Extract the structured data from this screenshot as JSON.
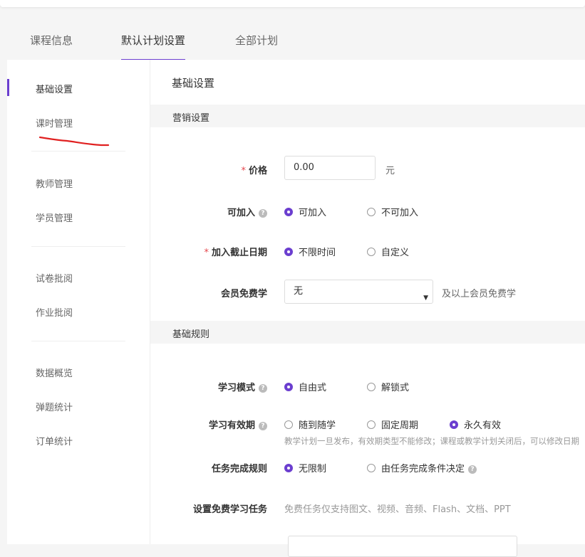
{
  "tabs": [
    "课程信息",
    "默认计划设置",
    "全部计划"
  ],
  "sidebar": {
    "items": [
      "基础设置",
      "课时管理",
      "教师管理",
      "学员管理",
      "试卷批阅",
      "作业批阅",
      "数据概览",
      "弹题统计",
      "订单统计"
    ]
  },
  "content": {
    "title": "基础设置",
    "marketing": {
      "header": "营销设置",
      "price_label": "价格",
      "price_value": "0.00",
      "price_unit": "元",
      "joinable_label": "可加入",
      "joinable_options": [
        "可加入",
        "不可加入"
      ],
      "deadline_label": "加入截止日期",
      "deadline_options": [
        "不限时间",
        "自定义"
      ],
      "vip_label": "会员免费学",
      "vip_selected": "无",
      "vip_suffix": "及以上会员免费学"
    },
    "rules": {
      "header": "基础规则",
      "mode_label": "学习模式",
      "mode_options": [
        "自由式",
        "解锁式"
      ],
      "validity_label": "学习有效期",
      "validity_options": [
        "随到随学",
        "固定周期",
        "永久有效"
      ],
      "validity_hint": "教学计划一旦发布，有效期类型不能修改；课程或教学计划关闭后，可以修改日期",
      "task_rule_label": "任务完成规则",
      "task_rule_options": [
        "无限制",
        "由任务完成条件决定"
      ],
      "free_task_label": "设置免费学习任务",
      "free_task_hint": "免费任务仅支持图文、视频、音频、Flash、文档、PPT"
    }
  },
  "colors": {
    "accent": "#6b3ecf",
    "required": "#e5484d",
    "annotation": "#e02020"
  },
  "icons": {
    "help": "question-circle-icon",
    "dropdown": "caret-down-icon"
  }
}
